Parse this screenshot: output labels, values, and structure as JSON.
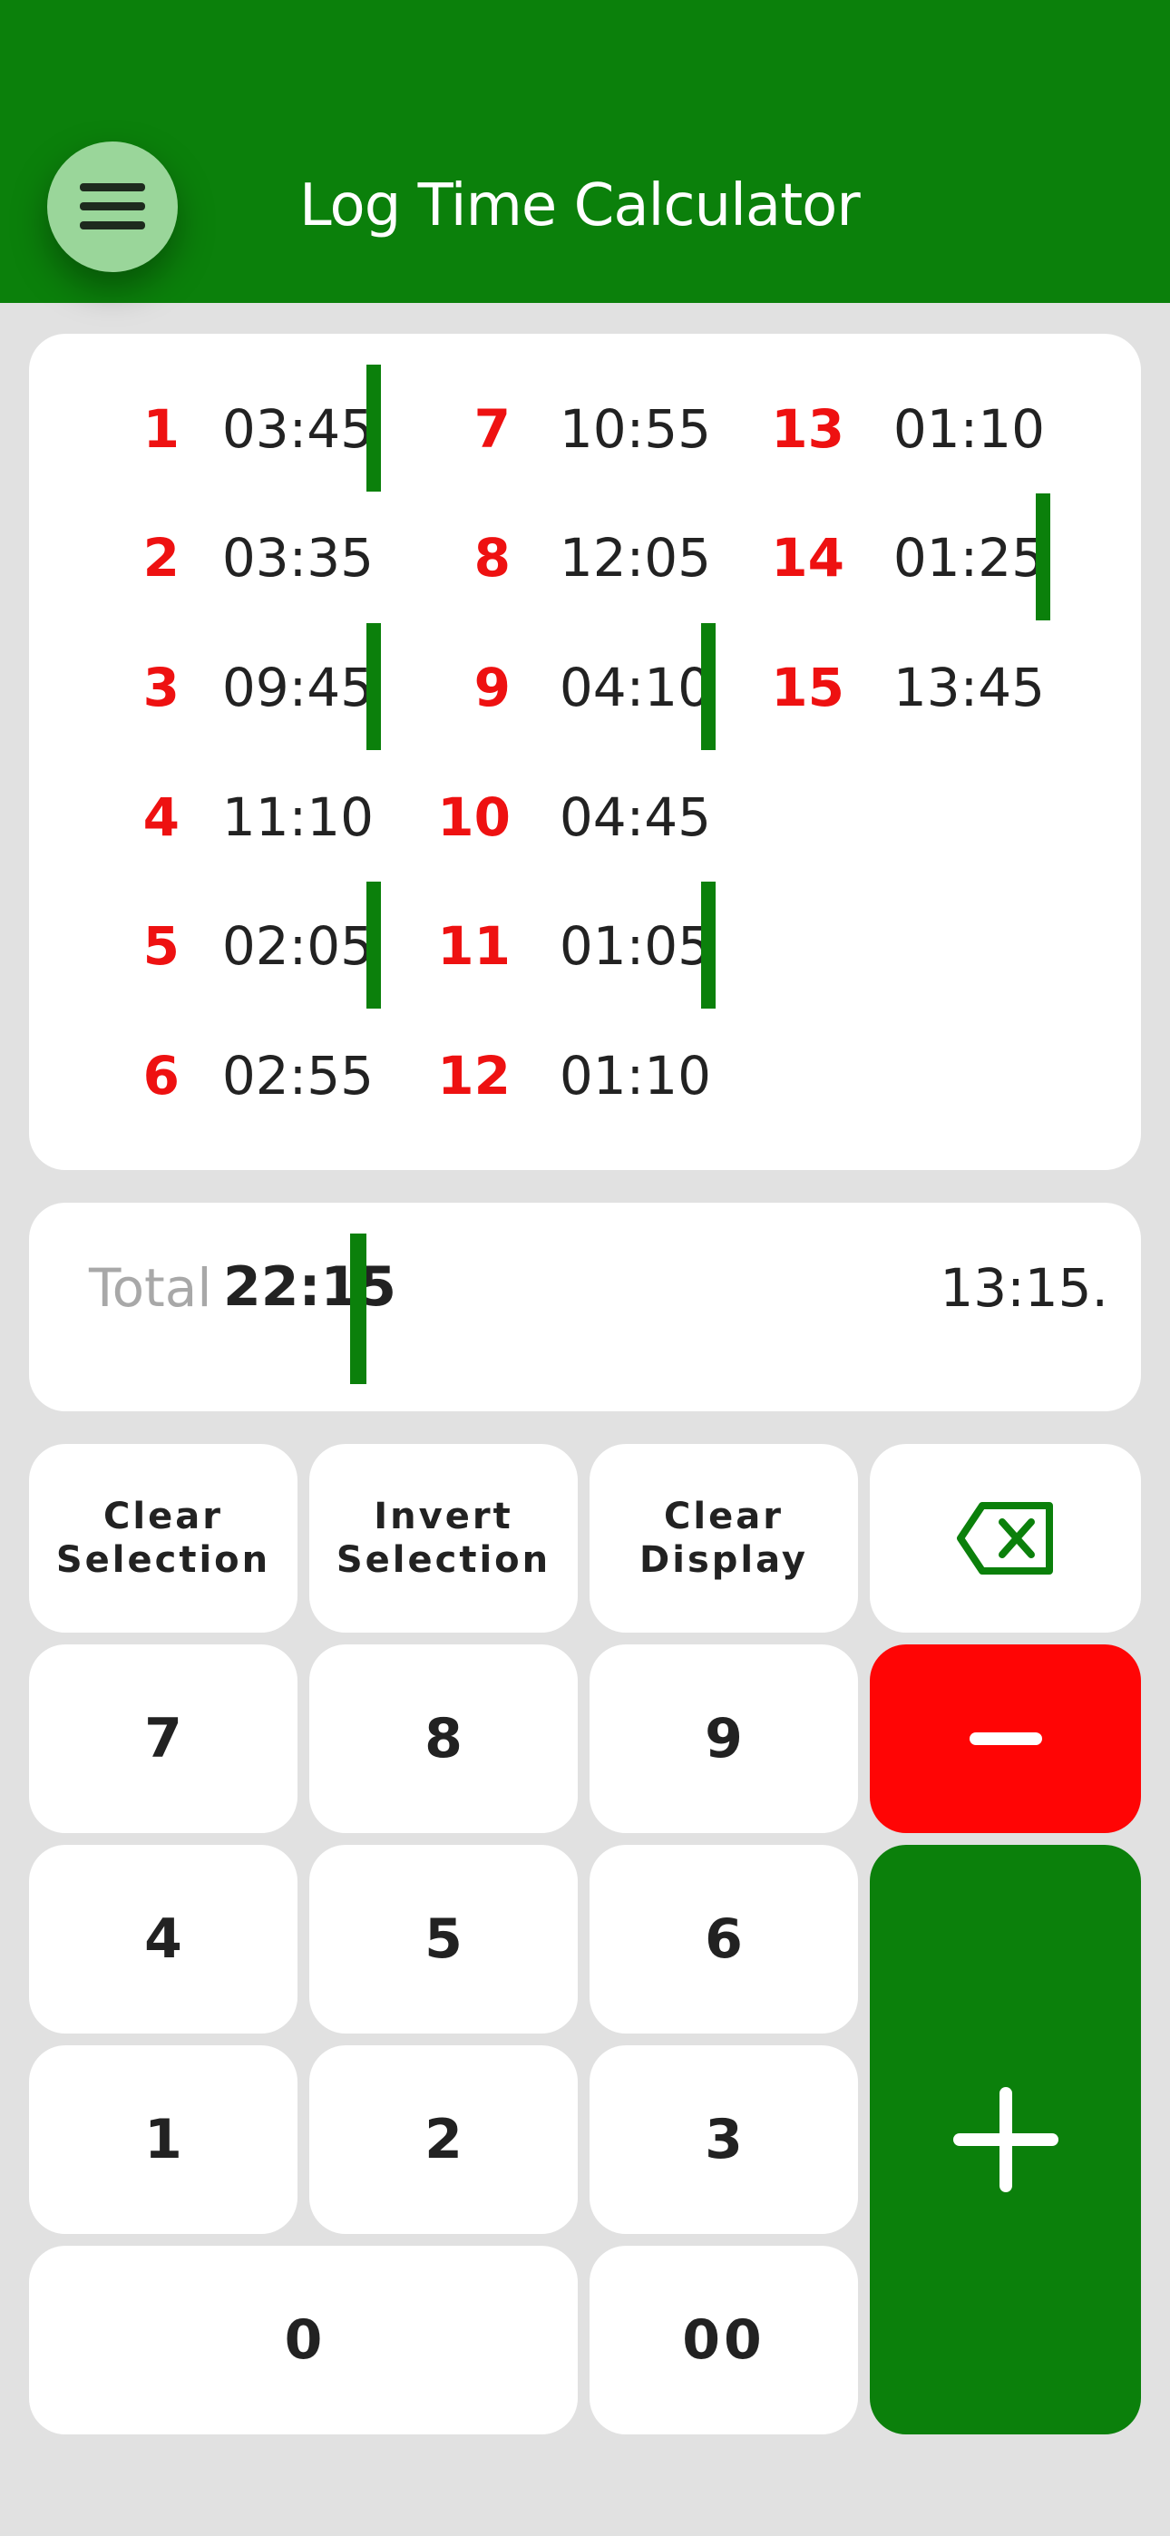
{
  "header": {
    "title": "Log Time Calculator",
    "color": "#0b800b",
    "menu_icon": "hamburger-menu-icon"
  },
  "log_entries": [
    {
      "num": "1",
      "time": "03:45",
      "selected": true
    },
    {
      "num": "2",
      "time": "03:35",
      "selected": false
    },
    {
      "num": "3",
      "time": "09:45",
      "selected": true
    },
    {
      "num": "4",
      "time": "11:10",
      "selected": false
    },
    {
      "num": "5",
      "time": "02:05",
      "selected": true
    },
    {
      "num": "6",
      "time": "02:55",
      "selected": false
    },
    {
      "num": "7",
      "time": "10:55",
      "selected": false
    },
    {
      "num": "8",
      "time": "12:05",
      "selected": false
    },
    {
      "num": "9",
      "time": "04:10",
      "selected": true
    },
    {
      "num": "10",
      "time": "04:45",
      "selected": false
    },
    {
      "num": "11",
      "time": "01:05",
      "selected": true
    },
    {
      "num": "12",
      "time": "01:10",
      "selected": false
    },
    {
      "num": "13",
      "time": "01:10",
      "selected": false
    },
    {
      "num": "14",
      "time": "01:25",
      "selected": true
    },
    {
      "num": "15",
      "time": "13:45",
      "selected": false
    }
  ],
  "total": {
    "label": "Total",
    "value": "22:15",
    "display": "13:15."
  },
  "keypad": {
    "clear_selection": "Clear\nSelection",
    "invert_selection": "Invert\nSelection",
    "clear_display": "Clear\nDisplay",
    "backspace_icon": "backspace-icon",
    "k7": "7",
    "k8": "8",
    "k9": "9",
    "k4": "4",
    "k5": "5",
    "k6": "6",
    "k1": "1",
    "k2": "2",
    "k3": "3",
    "k0": "0",
    "k00": "00",
    "minus_icon": "minus-icon",
    "plus_icon": "plus-icon"
  },
  "colors": {
    "accent_green": "#0b800b",
    "number_red": "#ee1111",
    "minus_red": "#ff0505",
    "background": "#e1e1e1"
  }
}
